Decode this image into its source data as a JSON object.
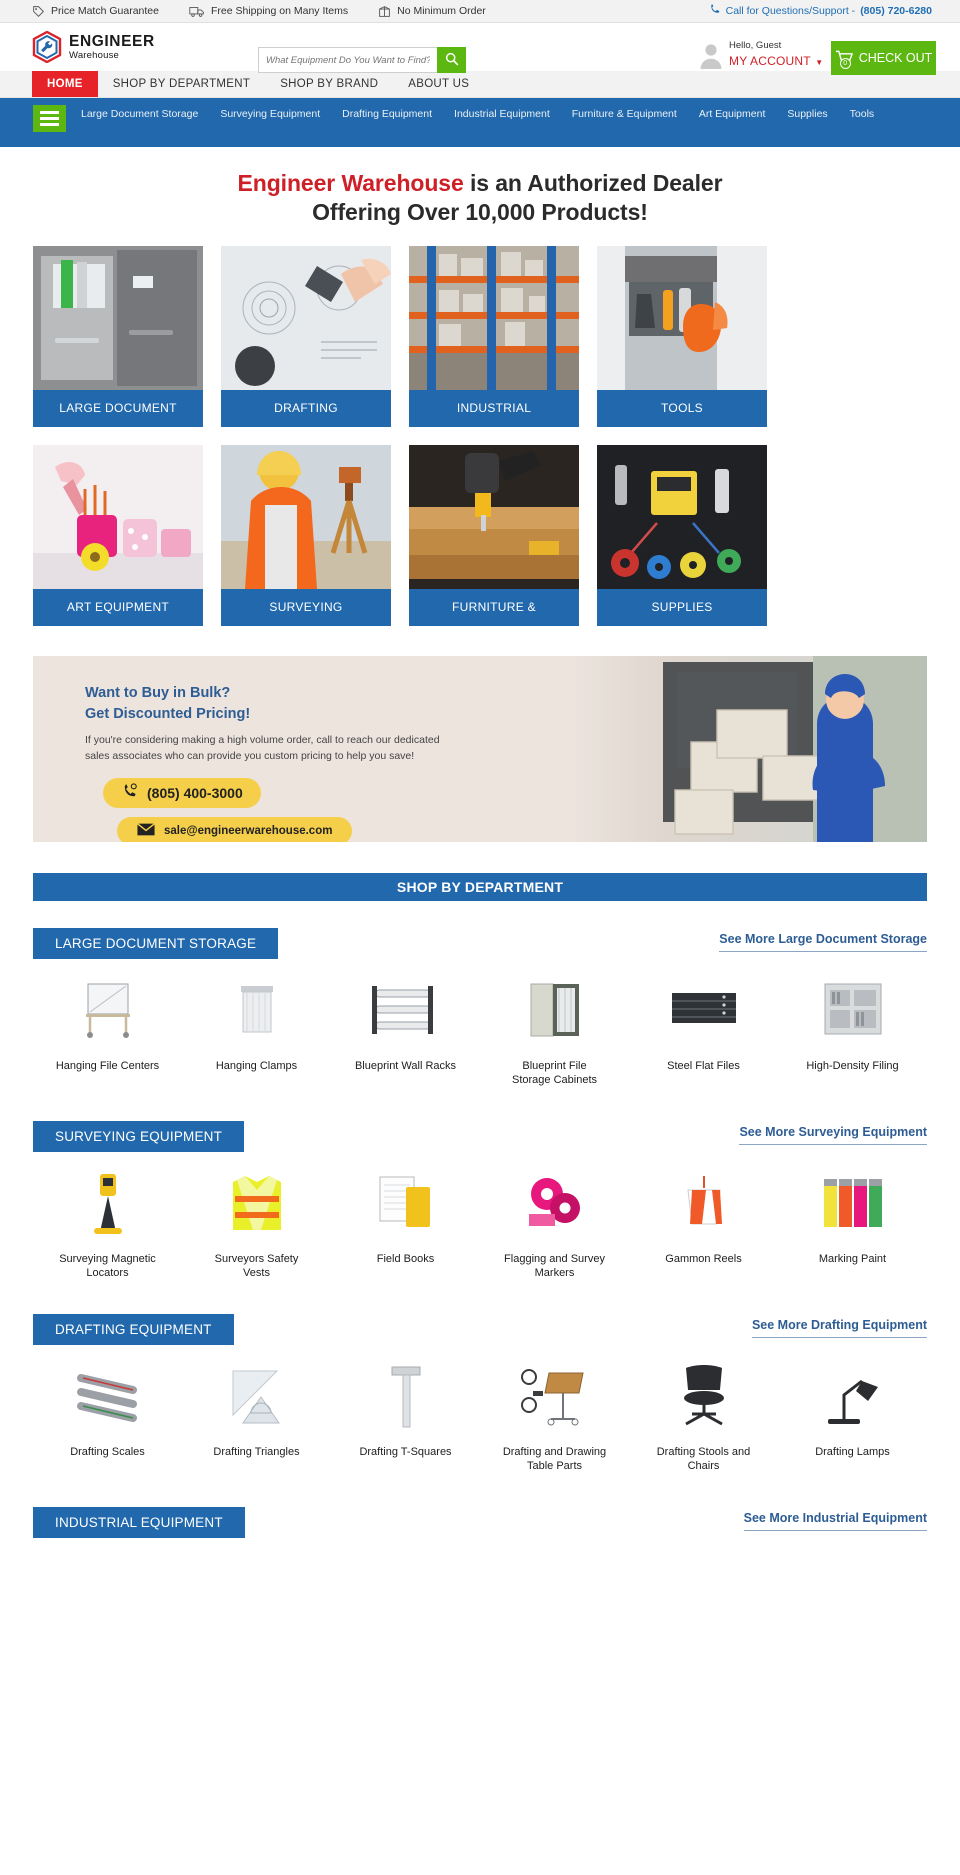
{
  "utility": {
    "items": [
      {
        "icon": "price-tag-icon",
        "label": "Price Match Guarantee"
      },
      {
        "icon": "truck-icon",
        "label": "Free Shipping on Many Items"
      },
      {
        "icon": "box-icon",
        "label": "No Minimum Order"
      }
    ],
    "support_label": "Call for Questions/Support - ",
    "support_phone": "(805) 720-6280"
  },
  "header": {
    "logo_main": "ENGINEER",
    "logo_sub": "Warehouse",
    "search_placeholder": "What Equipment Do You Want to Find?",
    "search_value": "",
    "hello": "Hello, Guest",
    "my_account": "MY ACCOUNT",
    "caret": "▼",
    "checkout": "CHECK OUT",
    "cart_count": "0"
  },
  "mainnav": {
    "items": [
      {
        "label": "HOME",
        "active": true
      },
      {
        "label": "SHOP BY DEPARTMENT",
        "active": false
      },
      {
        "label": "SHOP BY BRAND",
        "active": false
      },
      {
        "label": "ABOUT US",
        "active": false
      }
    ]
  },
  "deptnav": {
    "links": [
      "Large Document Storage",
      "Surveying Equipment",
      "Drafting Equipment",
      "Industrial Equipment",
      "Furniture & Equipment",
      "Art Equipment",
      "Supplies",
      "Tools"
    ]
  },
  "hero": {
    "highlight": "Engineer Warehouse",
    "line1_rest": " is an Authorized Dealer",
    "line2": "Offering Over 10,000 Products!"
  },
  "tiles": [
    {
      "label": "LARGE DOCUMENT",
      "image": "filing-cabinet-photo"
    },
    {
      "label": "DRAFTING",
      "image": "drafting-blueprint-photo"
    },
    {
      "label": "INDUSTRIAL",
      "image": "warehouse-shelving-photo"
    },
    {
      "label": "TOOLS",
      "image": "tool-belt-gloves-photo"
    },
    {
      "label": "ART EQUIPMENT",
      "image": "art-supplies-photo"
    },
    {
      "label": "SURVEYING",
      "image": "surveyor-theodolite-photo"
    },
    {
      "label": "FURNITURE &",
      "image": "power-drill-wood-photo"
    },
    {
      "label": "SUPPLIES",
      "image": "tools-tape-flatlay-photo"
    }
  ],
  "bulk": {
    "heading_line1": "Want to Buy in Bulk?",
    "heading_line2": "Get Discounted Pricing!",
    "body_line1": "If you're considering making a high volume order, call to reach our dedicated",
    "body_line2": "sales associates who can provide you custom pricing to help you save!",
    "phone": "(805) 400-3000",
    "email": "sale@engineerwarehouse.com",
    "photo": "delivery-woman-boxes-van-photo"
  },
  "shop_by_department": {
    "title": "SHOP BY DEPARTMENT",
    "sections": [
      {
        "tag": "LARGE DOCUMENT STORAGE",
        "see_more": "See More Large Document Storage",
        "products": [
          {
            "name": "Hanging File Centers",
            "image": "hanging-file-center-photo"
          },
          {
            "name": "Hanging Clamps",
            "image": "hanging-clamp-photo"
          },
          {
            "name": "Blueprint Wall Racks",
            "image": "blueprint-wall-rack-photo"
          },
          {
            "name": "Blueprint File Storage Cabinets",
            "image": "blueprint-file-cabinet-photo"
          },
          {
            "name": "Steel Flat Files",
            "image": "steel-flat-file-photo"
          },
          {
            "name": "High-Density Filing",
            "image": "high-density-filing-photo"
          }
        ]
      },
      {
        "tag": "SURVEYING EQUIPMENT",
        "see_more": "See More Surveying Equipment",
        "products": [
          {
            "name": "Surveying Magnetic Locators",
            "image": "magnetic-locator-photo"
          },
          {
            "name": "Surveyors Safety Vests",
            "image": "safety-vest-photo"
          },
          {
            "name": "Field Books",
            "image": "field-book-photo"
          },
          {
            "name": "Flagging and Survey Markers",
            "image": "flagging-tape-photo"
          },
          {
            "name": "Gammon Reels",
            "image": "gammon-reel-photo"
          },
          {
            "name": "Marking Paint",
            "image": "marking-paint-photo"
          }
        ]
      },
      {
        "tag": "DRAFTING EQUIPMENT",
        "see_more": "See More Drafting Equipment",
        "products": [
          {
            "name": "Drafting Scales",
            "image": "drafting-scale-photo"
          },
          {
            "name": "Drafting Triangles",
            "image": "drafting-triangle-photo"
          },
          {
            "name": "Drafting T-Squares",
            "image": "t-square-photo"
          },
          {
            "name": "Drafting and Drawing Table Parts",
            "image": "drawing-table-parts-photo"
          },
          {
            "name": "Drafting Stools and Chairs",
            "image": "drafting-stool-photo"
          },
          {
            "name": "Drafting Lamps",
            "image": "drafting-lamp-photo"
          }
        ]
      },
      {
        "tag": "INDUSTRIAL EQUIPMENT",
        "see_more": "See More Industrial Equipment",
        "products": []
      }
    ]
  },
  "colors": {
    "brand_blue": "#2168ad",
    "brand_red": "#e52329",
    "accent_green": "#5cb811",
    "bulk_bg": "#ece4dd",
    "pill_yellow": "#f6cf4a",
    "link_blue": "#2d5d94"
  }
}
